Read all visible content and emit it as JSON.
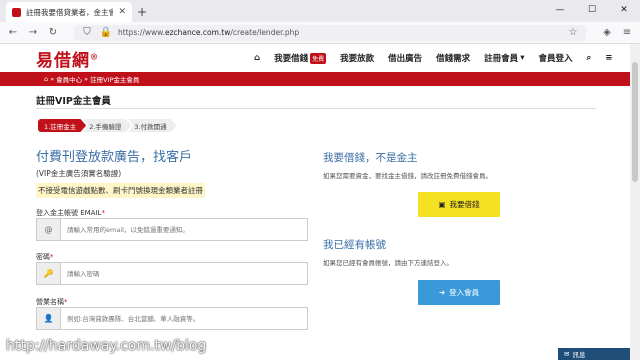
{
  "browser": {
    "tab_title": "註冊我要借貸業者，金主會員",
    "tab_close": "✕",
    "new_tab": "+",
    "win_minimize": "—",
    "win_maximize": "☐",
    "win_close": "✕",
    "url_prefix": "https://www.",
    "url_domain": "ezchance.com.tw",
    "url_path": "/create/lender.php"
  },
  "site": {
    "logo": "易借網",
    "logo_mark": "®",
    "nav": {
      "borrow": "我要借錢",
      "borrow_badge": "免費",
      "lend": "我要放款",
      "lend_ads": "借出廣告",
      "loan_needs": "借錢需求",
      "register": "註冊會員",
      "register_caret": "▾",
      "login": "會員登入"
    },
    "breadcrumb": {
      "home_icon": "⌂",
      "sep1": "»",
      "member_center": "會員中心",
      "sep2": "»",
      "current": "註冊VIP金主會員"
    }
  },
  "page": {
    "title": "註冊VIP金主會員",
    "steps": [
      "1.註冊金主",
      "2.手機驗證",
      "3.付款開通"
    ],
    "left": {
      "heading": "付費刊登放款廣告，找客戶",
      "subheading": "(VIP金主廣告須實名驗證)",
      "notice": "不接受電信遊戲點數、刷卡鬥號換現金類業者註冊",
      "email_label": "登入金主帳號 EMAIL",
      "req_mark": "*",
      "email_icon": "@",
      "email_placeholder": "請輸入常用的email，以免錯過重要通知。",
      "password_label": "密碼",
      "password_icon": "🔑",
      "password_placeholder": "請輸入密碼",
      "name_label": "營業名稱",
      "name_icon": "👤",
      "name_placeholder": "例如:台灣貸款團隊、台北當舖、華人融資等。"
    },
    "right": {
      "heading1": "我要借錢，不是金主",
      "text1": "如果您需要資金，要找金主借錢，請改註冊免費借錢會員。",
      "borrow_button": "我要借錢",
      "borrow_button_icon": "▣",
      "heading2": "我已經有帳號",
      "text2": "如果您已經有會員帳號，請由下方連結登入。",
      "login_button": "登入會員",
      "login_button_icon": "➜"
    }
  },
  "overlay": {
    "watermark": "http://hardaway.com.tw/blog",
    "message_tab": "訊息",
    "message_icon": "✉"
  }
}
